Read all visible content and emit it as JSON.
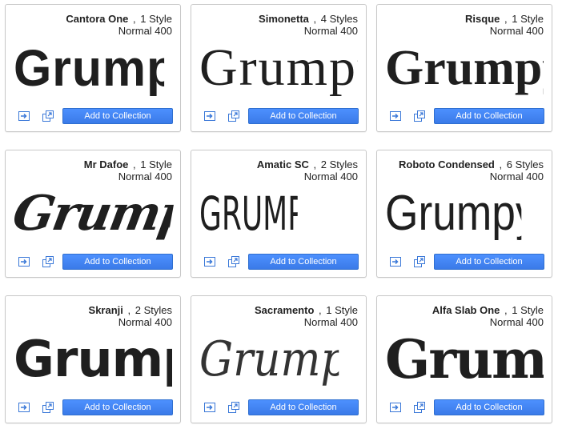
{
  "preview_text": "Grumpy wizards",
  "add_label": "Add to Collection",
  "fonts": [
    {
      "name": "Cantora One",
      "styles": "1 Style",
      "weight": "Normal 400"
    },
    {
      "name": "Simonetta",
      "styles": "4 Styles",
      "weight": "Normal 400"
    },
    {
      "name": "Risque",
      "styles": "1 Style",
      "weight": "Normal 400"
    },
    {
      "name": "Mr Dafoe",
      "styles": "1 Style",
      "weight": "Normal 400"
    },
    {
      "name": "Amatic SC",
      "styles": "2 Styles",
      "weight": "Normal 400"
    },
    {
      "name": "Roboto Condensed",
      "styles": "6 Styles",
      "weight": "Normal 400"
    },
    {
      "name": "Skranji",
      "styles": "2 Styles",
      "weight": "Normal 400"
    },
    {
      "name": "Sacramento",
      "styles": "1 Style",
      "weight": "Normal 400"
    },
    {
      "name": "Alfa Slab One",
      "styles": "1 Style",
      "weight": "Normal 400"
    }
  ],
  "colors": {
    "button": "#4d90fe",
    "border": "#c8c8c8",
    "icon": "#3a78d8"
  },
  "icons": {
    "quick_use": "quick-use-icon",
    "pop_out": "pop-out-icon"
  }
}
